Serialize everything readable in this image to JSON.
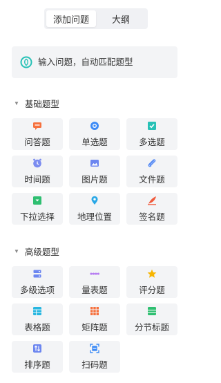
{
  "tabs": [
    {
      "label": "添加问题",
      "active": true
    },
    {
      "label": "大纲",
      "active": false
    }
  ],
  "search": {
    "placeholder": "输入问题，自动匹配题型"
  },
  "sections": {
    "basic": {
      "title": "基础题型",
      "items": [
        {
          "label": "问答题",
          "icon": "chat-icon",
          "color": "#f6713e"
        },
        {
          "label": "单选题",
          "icon": "radio-icon",
          "color": "#3d8bf6"
        },
        {
          "label": "多选题",
          "icon": "checkbox-icon",
          "color": "#27c1b6"
        },
        {
          "label": "时间题",
          "icon": "clock-icon",
          "color": "#7b8cf0"
        },
        {
          "label": "图片题",
          "icon": "image-icon",
          "color": "#6c86f0"
        },
        {
          "label": "文件题",
          "icon": "paperclip-icon",
          "color": "#5b8ef5"
        },
        {
          "label": "下拉选择",
          "icon": "dropdown-icon",
          "color": "#2fbf71"
        },
        {
          "label": "地理位置",
          "icon": "location-pin-icon",
          "color": "#28a7e6"
        },
        {
          "label": "签名题",
          "icon": "quill-icon",
          "color": "#f05a3c"
        }
      ]
    },
    "advanced": {
      "title": "高级题型",
      "items": [
        {
          "label": "多级选项",
          "icon": "cascade-icon",
          "color": "#6c86f0"
        },
        {
          "label": "量表题",
          "icon": "scale-icon",
          "color": "#b67cf2"
        },
        {
          "label": "评分题",
          "icon": "star-icon",
          "color": "#f7b500"
        },
        {
          "label": "表格题",
          "icon": "table-icon",
          "color": "#27b6e0"
        },
        {
          "label": "矩阵题",
          "icon": "matrix-icon",
          "color": "#f6713e"
        },
        {
          "label": "分节标题",
          "icon": "section-icon",
          "color": "#2fbf71"
        },
        {
          "label": "排序题",
          "icon": "sort-icon",
          "color": "#6c86f0"
        },
        {
          "label": "扫码题",
          "icon": "scan-icon",
          "color": "#3d8bf6"
        }
      ]
    }
  }
}
